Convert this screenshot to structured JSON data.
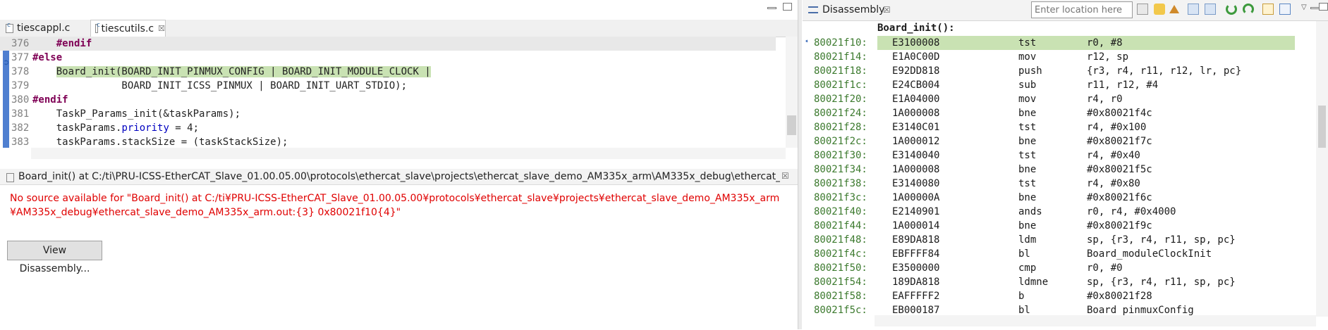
{
  "editor": {
    "tabs": [
      {
        "label": "tiescappl.c"
      },
      {
        "label": "tiescutils.c",
        "close": "☒"
      }
    ],
    "lines": [
      {
        "num": "376",
        "html_parts": [
          {
            "t": "    "
          },
          {
            "t": "#endif",
            "c": "kw"
          }
        ]
      },
      {
        "num": "377",
        "html_parts": [
          {
            "t": "#else",
            "c": "kw"
          }
        ]
      },
      {
        "num": "378",
        "html_parts": [
          {
            "t": "    "
          },
          {
            "t": "Board_init(BOARD_INIT_PINMUX_CONFIG | BOARD_INIT_MODULE_CLOCK |",
            "c": "hl"
          }
        ]
      },
      {
        "num": "379",
        "html_parts": [
          {
            "t": "               BOARD_INIT_ICSS_PINMUX | BOARD_INIT_UART_STDIO);"
          }
        ]
      },
      {
        "num": "380",
        "html_parts": [
          {
            "t": "#endif",
            "c": "kw"
          }
        ]
      },
      {
        "num": "381",
        "html_parts": [
          {
            "t": "    TaskP_Params_init(&taskParams);"
          }
        ]
      },
      {
        "num": "382",
        "html_parts": [
          {
            "t": "    taskParams."
          },
          {
            "t": "priority",
            "c": "field"
          },
          {
            "t": " = 4;"
          }
        ]
      },
      {
        "num": "383",
        "html_parts": [
          {
            "t": "    taskParams.stackSize = (taskStackSize);"
          }
        ]
      }
    ]
  },
  "info_panel": {
    "title": "Board_init() at C:/ti\\PRU-ICSS-EtherCAT_Slave_01.00.05.00\\protocols\\ethercat_slave\\projects\\ethercat_slave_demo_AM335x_arm\\AM335x_debug\\ethercat_slave_...",
    "close": "☒",
    "message_line1": "No source available for \"Board_init() at C:/ti¥PRU-ICSS-EtherCAT_Slave_01.00.05.00¥protocols¥ethercat_slave¥projects¥ethercat_slave_demo_AM335x_arm",
    "message_line2": "¥AM335x_debug¥ethercat_slave_demo_AM335x_arm.out:{3} 0x80021f10{4}\"",
    "button": "View Disassembly..."
  },
  "disassembly": {
    "tab_label": "Disassembly",
    "tab_close": "☒",
    "location_placeholder": "Enter location here",
    "function_label": "Board_init():",
    "rows": [
      {
        "addr": "80021f10:",
        "op": "E3100008",
        "mn": "tst",
        "args": "r0, #8"
      },
      {
        "addr": "80021f14:",
        "op": "E1A0C00D",
        "mn": "mov",
        "args": "r12, sp"
      },
      {
        "addr": "80021f18:",
        "op": "E92DD818",
        "mn": "push",
        "args": "{r3, r4, r11, r12, lr, pc}"
      },
      {
        "addr": "80021f1c:",
        "op": "E24CB004",
        "mn": "sub",
        "args": "r11, r12, #4"
      },
      {
        "addr": "80021f20:",
        "op": "E1A04000",
        "mn": "mov",
        "args": "r4, r0"
      },
      {
        "addr": "80021f24:",
        "op": "1A000008",
        "mn": "bne",
        "args": "#0x80021f4c"
      },
      {
        "addr": "80021f28:",
        "op": "E3140C01",
        "mn": "tst",
        "args": "r4, #0x100"
      },
      {
        "addr": "80021f2c:",
        "op": "1A000012",
        "mn": "bne",
        "args": "#0x80021f7c"
      },
      {
        "addr": "80021f30:",
        "op": "E3140040",
        "mn": "tst",
        "args": "r4, #0x40"
      },
      {
        "addr": "80021f34:",
        "op": "1A000008",
        "mn": "bne",
        "args": "#0x80021f5c"
      },
      {
        "addr": "80021f38:",
        "op": "E3140080",
        "mn": "tst",
        "args": "r4, #0x80"
      },
      {
        "addr": "80021f3c:",
        "op": "1A00000A",
        "mn": "bne",
        "args": "#0x80021f6c"
      },
      {
        "addr": "80021f40:",
        "op": "E2140901",
        "mn": "ands",
        "args": "r0, r4, #0x4000"
      },
      {
        "addr": "80021f44:",
        "op": "1A000014",
        "mn": "bne",
        "args": "#0x80021f9c"
      },
      {
        "addr": "80021f48:",
        "op": "E89DA818",
        "mn": "ldm",
        "args": "sp, {r3, r4, r11, sp, pc}"
      },
      {
        "addr": "80021f4c:",
        "op": "EBFFFF84",
        "mn": "bl",
        "args": "Board_moduleClockInit"
      },
      {
        "addr": "80021f50:",
        "op": "E3500000",
        "mn": "cmp",
        "args": "r0, #0"
      },
      {
        "addr": "80021f54:",
        "op": "189DA818",
        "mn": "ldmne",
        "args": "sp, {r3, r4, r11, sp, pc}"
      },
      {
        "addr": "80021f58:",
        "op": "EAFFFFF2",
        "mn": "b",
        "args": "#0x80021f28"
      },
      {
        "addr": "80021f5c:",
        "op": "EB000187",
        "mn": "bl",
        "args": "Board_pinmuxConfig"
      }
    ]
  }
}
